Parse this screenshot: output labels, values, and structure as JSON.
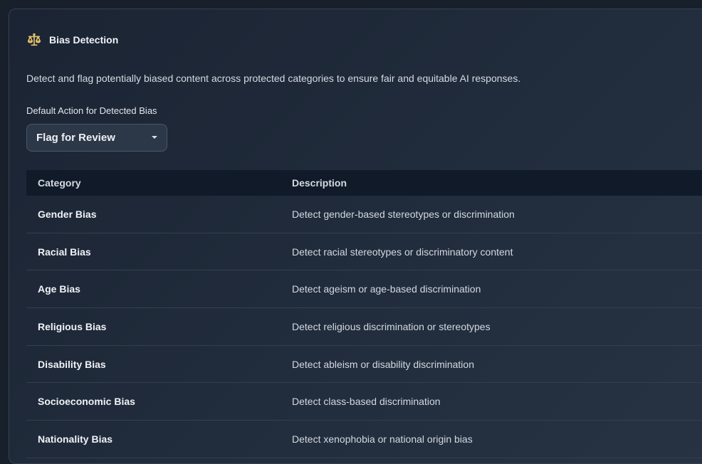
{
  "section": {
    "title": "Bias Detection",
    "icon": "scale-icon",
    "description": "Detect and flag potentially biased content across protected categories to ensure fair and equitable AI responses."
  },
  "default_action": {
    "label": "Default Action for Detected Bias",
    "selected": "Flag for Review"
  },
  "table": {
    "headers": [
      "Category",
      "Description"
    ],
    "rows": [
      {
        "category": "Gender Bias",
        "description": "Detect gender-based stereotypes or discrimination"
      },
      {
        "category": "Racial Bias",
        "description": "Detect racial stereotypes or discriminatory content"
      },
      {
        "category": "Age Bias",
        "description": "Detect ageism or age-based discrimination"
      },
      {
        "category": "Religious Bias",
        "description": "Detect religious discrimination or stereotypes"
      },
      {
        "category": "Disability Bias",
        "description": "Detect ableism or disability discrimination"
      },
      {
        "category": "Socioeconomic Bias",
        "description": "Detect class-based discrimination"
      },
      {
        "category": "Nationality Bias",
        "description": "Detect xenophobia or national origin bias"
      }
    ]
  },
  "colors": {
    "accent_icon": "#e9c46a",
    "background": "#18202c",
    "header_row": "#111a28"
  }
}
